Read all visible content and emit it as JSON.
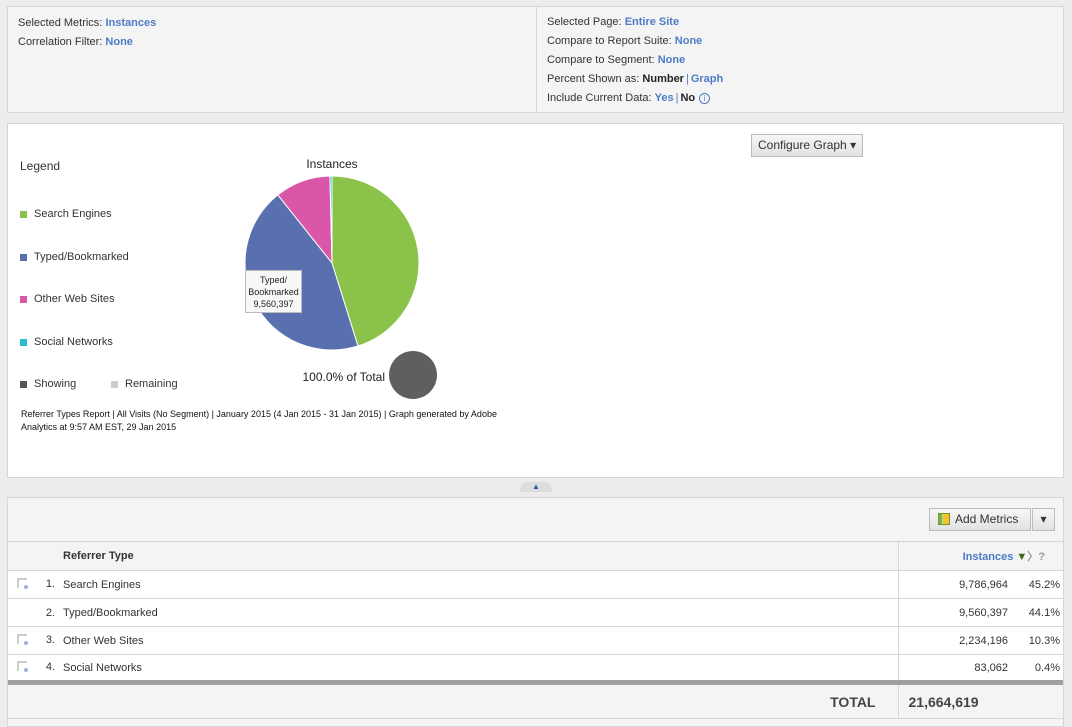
{
  "summary": {
    "selected_metrics_label": "Selected Metrics:",
    "selected_metrics_value": "Instances",
    "correlation_label": "Correlation Filter:",
    "correlation_value": "None",
    "selected_page_label": "Selected Page:",
    "selected_page_value": "Entire Site",
    "compare_suite_label": "Compare to Report Suite:",
    "compare_suite_value": "None",
    "compare_segment_label": "Compare to Segment:",
    "compare_segment_value": "None",
    "percent_label": "Percent Shown as:",
    "percent_number": "Number",
    "percent_graph": "Graph",
    "current_label": "Include Current Data:",
    "current_yes": "Yes",
    "current_no": "No",
    "info_icon": "i"
  },
  "graph": {
    "configure_label": "Configure Graph",
    "legend_title": "Legend",
    "showing_label": "Showing",
    "remaining_label": "Remaining",
    "pct_total": "100.0% of Total",
    "tooltip": {
      "label1": "Typed/",
      "label2": "Bookmarked",
      "value": "9,560,397"
    },
    "footnote": "Referrer Types Report | All Visits (No Segment) | January 2015 (4 Jan 2015 - 31 Jan 2015) | Graph generated by Adobe Analytics at  9:57 AM EST, 29 Jan 2015"
  },
  "chart_data": {
    "type": "pie",
    "title": "Instances",
    "categories": [
      "Search Engines",
      "Typed/Bookmarked",
      "Other Web Sites",
      "Social Networks"
    ],
    "values": [
      9786964,
      9560397,
      2234196,
      83062
    ],
    "colors": [
      "#8bc34a",
      "#5a6fae",
      "#d956a8",
      "#2bbcd4"
    ],
    "legend": "left"
  },
  "table": {
    "add_metrics_label": "Add Metrics",
    "col_dimension": "Referrer Type",
    "col_metric": "Instances",
    "rows": [
      {
        "rank": "1.",
        "name": "Search Engines",
        "value": "9,786,964",
        "pct": "45.2%",
        "breakdown": true
      },
      {
        "rank": "2.",
        "name": "Typed/Bookmarked",
        "value": "9,560,397",
        "pct": "44.1%",
        "breakdown": false
      },
      {
        "rank": "3.",
        "name": "Other Web Sites",
        "value": "2,234,196",
        "pct": "10.3%",
        "breakdown": true
      },
      {
        "rank": "4.",
        "name": "Social Networks",
        "value": "83,062",
        "pct": "0.4%",
        "breakdown": true
      }
    ],
    "total_label": "TOTAL",
    "total_value": "21,664,619"
  }
}
